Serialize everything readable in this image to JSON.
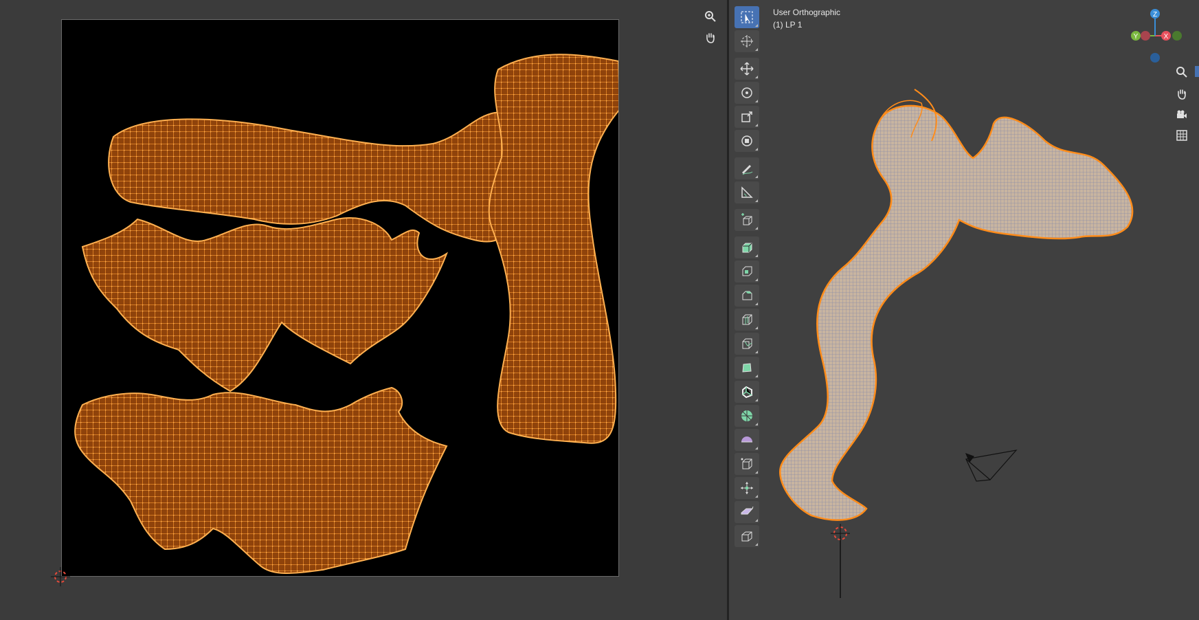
{
  "viewport": {
    "view_name": "User Orthographic",
    "object_label": "(1) LP 1"
  },
  "uv_editor": {
    "nav_icons": [
      "zoom-icon",
      "hand-pan-icon"
    ]
  },
  "toolbar": {
    "tools": [
      {
        "name": "select-box-tool",
        "active": true
      },
      {
        "name": "cursor-tool"
      },
      {
        "name": "move-tool"
      },
      {
        "name": "rotate-tool"
      },
      {
        "name": "scale-tool"
      },
      {
        "name": "transform-tool"
      },
      {
        "name": "annotate-tool"
      },
      {
        "name": "measure-tool"
      },
      {
        "name": "add-cube-tool"
      },
      {
        "name": "extrude-region-tool"
      },
      {
        "name": "inset-faces-tool"
      },
      {
        "name": "bevel-tool"
      },
      {
        "name": "loop-cut-tool"
      },
      {
        "name": "knife-tool"
      },
      {
        "name": "poly-build-tool"
      },
      {
        "name": "spin-tool"
      },
      {
        "name": "smooth-tool"
      },
      {
        "name": "edge-slide-tool"
      },
      {
        "name": "shrink-fatten-tool"
      },
      {
        "name": "shear-tool"
      },
      {
        "name": "rip-region-tool"
      },
      {
        "name": "cube-outline-tool"
      }
    ]
  },
  "gizmo": {
    "axes": [
      "Z",
      "Y",
      "X"
    ],
    "colors": {
      "x": "#e8505c",
      "y": "#7ab83e",
      "z": "#3a8ed8"
    }
  },
  "colors": {
    "uv_fill": "#9c4a0c",
    "uv_line": "#ff9a2a",
    "selection": "#ff8c1a",
    "active_tool": "#4772b3"
  }
}
